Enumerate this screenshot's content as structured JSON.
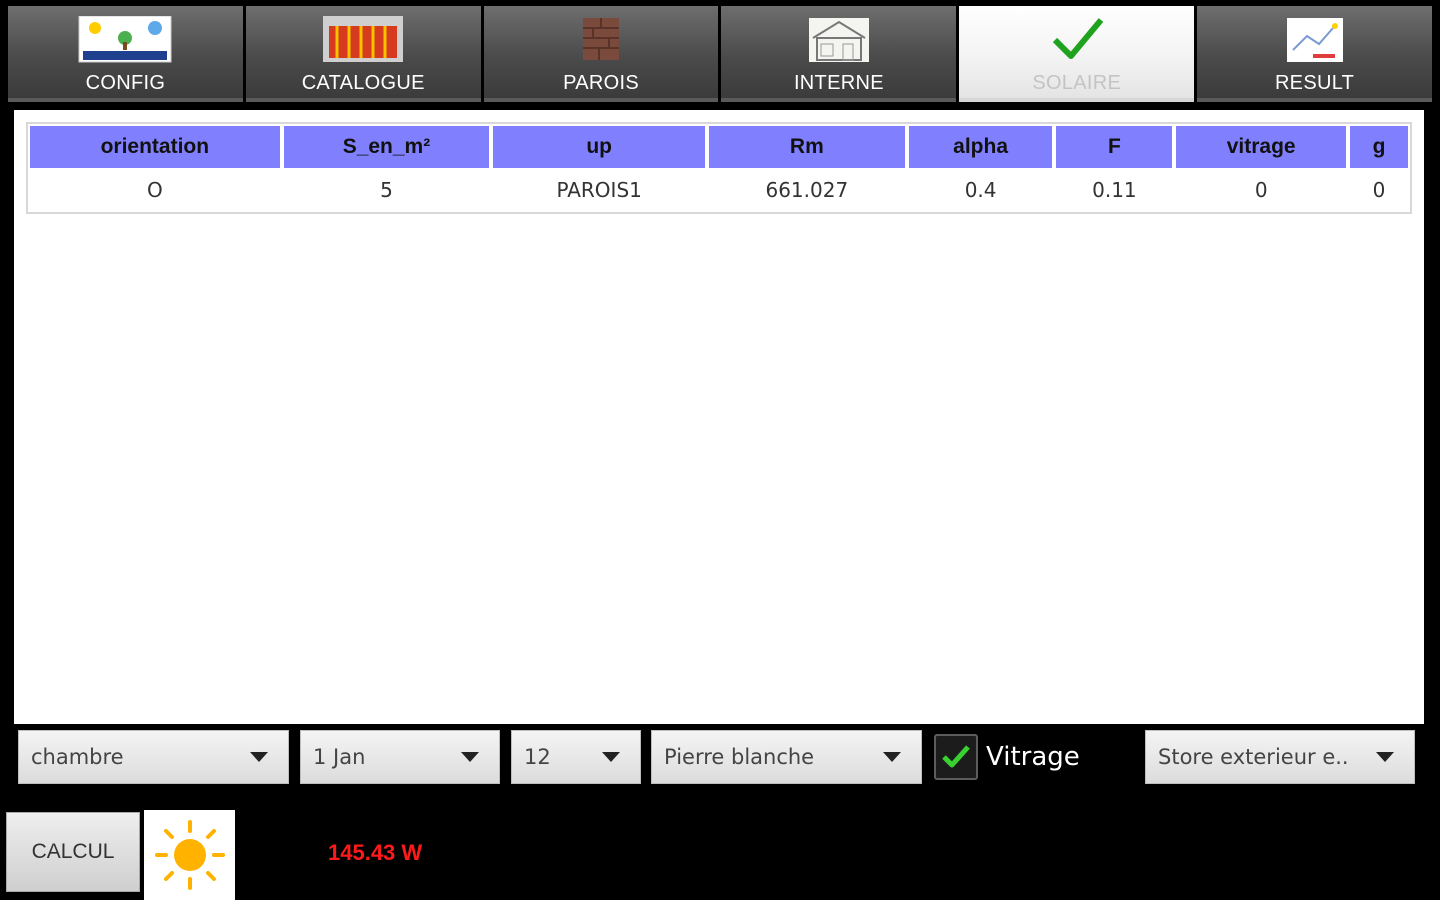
{
  "tabs": [
    {
      "label": "CONFIG",
      "icon": "tecandroid-logo-icon",
      "active": false
    },
    {
      "label": "CATALOGUE",
      "icon": "radiator-catalogue-icon",
      "active": false
    },
    {
      "label": "PAROIS",
      "icon": "brick-wall-icon",
      "active": false
    },
    {
      "label": "INTERNE",
      "icon": "house-interior-icon",
      "active": false
    },
    {
      "label": "SOLAIRE",
      "icon": "checkmark-icon",
      "active": true
    },
    {
      "label": "RESULT",
      "icon": "result-sketch-icon",
      "active": false
    }
  ],
  "table": {
    "headers": [
      "orientation",
      "S_en_m²",
      "up",
      "Rm",
      "alpha",
      "F",
      "vitrage",
      "g"
    ],
    "rows": [
      [
        "O",
        "5",
        "PAROIS1",
        "661.027",
        "0.4",
        "0.11",
        "0",
        "0"
      ]
    ]
  },
  "controls": {
    "room_select": "chambre",
    "date_select": "1 Jan",
    "hour_select": "12",
    "material_select": "Pierre blanche",
    "vitrage_checkbox": {
      "label": "Vitrage",
      "checked": true
    },
    "store_select": "Store exterieur e.."
  },
  "bottom": {
    "calc_button": "CALCUL",
    "result": "145.43 W"
  },
  "colors": {
    "header_bg": "#8080ff",
    "result_text": "#ff1a1a",
    "check_green": "#39d12f",
    "sun": "#ffb300"
  }
}
